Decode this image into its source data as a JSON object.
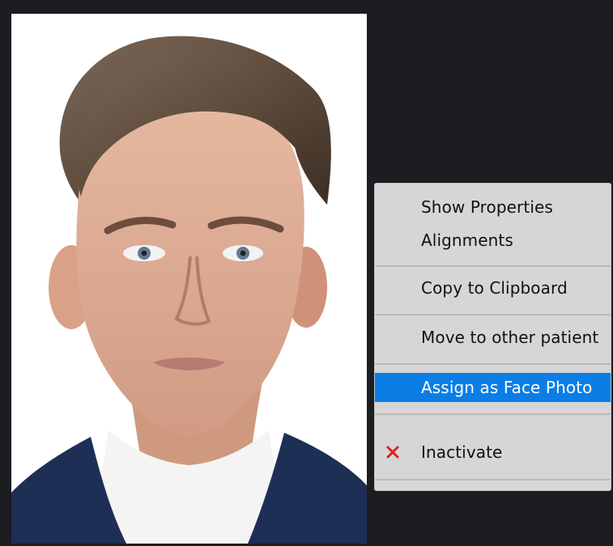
{
  "photo": {
    "subject": "face-photo"
  },
  "context_menu": {
    "items": [
      {
        "label": "Show Properties"
      },
      {
        "label": "Alignments"
      },
      {
        "label": "Copy to Clipboard"
      },
      {
        "label": "Move to other patient"
      },
      {
        "label": "Assign as Face Photo",
        "selected": true
      },
      {
        "label": "Inactivate",
        "icon": "close-icon",
        "icon_color": "#e31b23"
      }
    ]
  },
  "colors": {
    "background": "#1b1d20",
    "menu_background": "#d6d6d6",
    "selection": "#0b7ee5",
    "danger": "#e31b23"
  }
}
